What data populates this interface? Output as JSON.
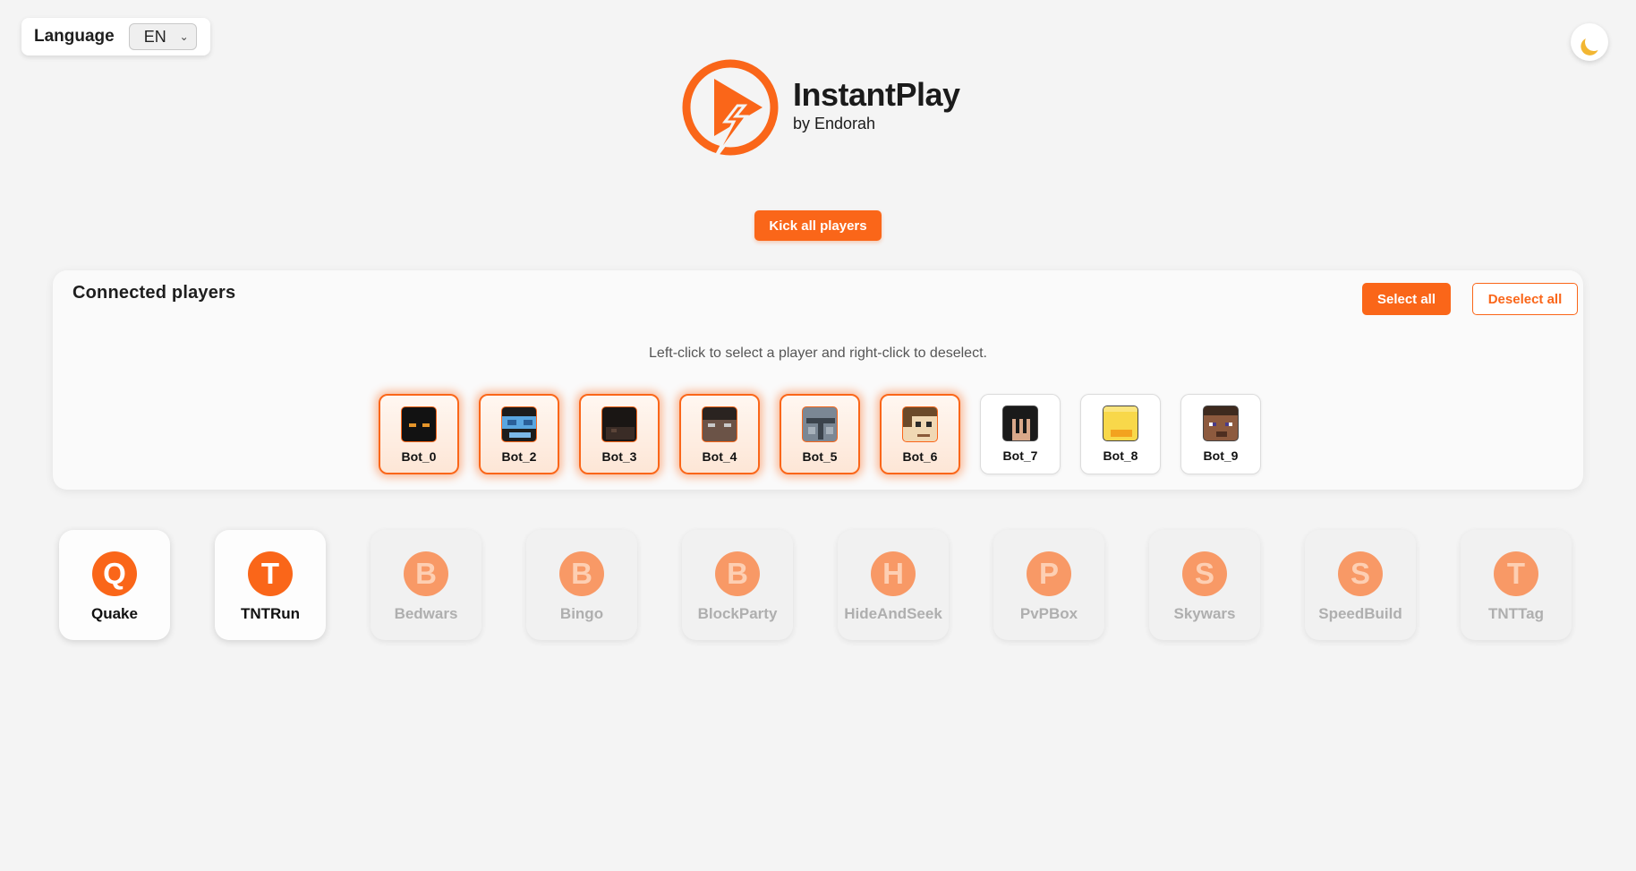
{
  "language": {
    "label": "Language",
    "value": "EN"
  },
  "theme_toggle_icon": "moon-icon",
  "logo": {
    "title": "InstantPlay",
    "subtitle": "by Endorah",
    "icon": "play-bolt-logo"
  },
  "kick_button": "Kick all players",
  "players_panel": {
    "title": "Connected players",
    "select_all": "Select all",
    "deselect_all": "Deselect all",
    "hint": "Left-click to select a player and right-click to deselect.",
    "players": [
      {
        "name": "Bot_0",
        "selected": true
      },
      {
        "name": "Bot_2",
        "selected": true
      },
      {
        "name": "Bot_3",
        "selected": true
      },
      {
        "name": "Bot_4",
        "selected": true
      },
      {
        "name": "Bot_5",
        "selected": true
      },
      {
        "name": "Bot_6",
        "selected": true
      },
      {
        "name": "Bot_7",
        "selected": false
      },
      {
        "name": "Bot_8",
        "selected": false
      },
      {
        "name": "Bot_9",
        "selected": false
      }
    ]
  },
  "games": [
    {
      "letter": "Q",
      "name": "Quake",
      "active": true
    },
    {
      "letter": "T",
      "name": "TNTRun",
      "active": true
    },
    {
      "letter": "B",
      "name": "Bedwars",
      "active": false
    },
    {
      "letter": "B",
      "name": "Bingo",
      "active": false
    },
    {
      "letter": "B",
      "name": "BlockParty",
      "active": false
    },
    {
      "letter": "H",
      "name": "HideAndSeek",
      "active": false
    },
    {
      "letter": "P",
      "name": "PvPBox",
      "active": false
    },
    {
      "letter": "S",
      "name": "Skywars",
      "active": false
    },
    {
      "letter": "S",
      "name": "SpeedBuild",
      "active": false
    },
    {
      "letter": "T",
      "name": "TNTTag",
      "active": false
    }
  ],
  "colors": {
    "accent": "#fa6619",
    "background": "#f4f4f4"
  }
}
